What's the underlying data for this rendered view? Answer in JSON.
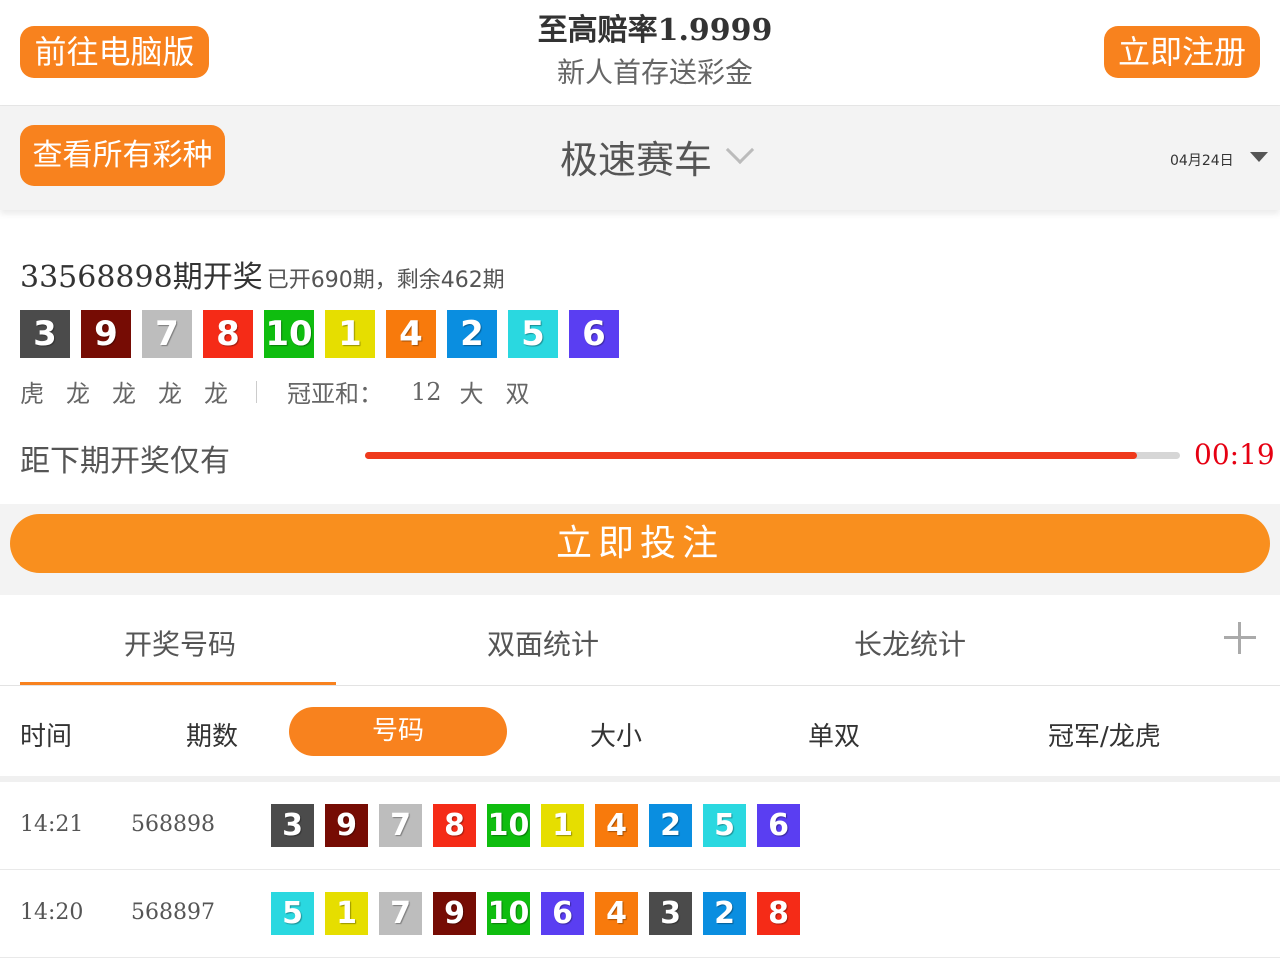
{
  "header": {
    "pc_button": "前往电脑版",
    "promo_line1": "至高赔率1.9999",
    "promo_line2": "新人首存送彩金",
    "register_button": "立即注册"
  },
  "selector": {
    "all_button": "查看所有彩种",
    "game_name": "极速赛车",
    "date": "04月24日"
  },
  "ball_colors": {
    "1": "#e6de00",
    "2": "#0a8ee0",
    "3": "#4b4b4b",
    "4": "#f87a0c",
    "5": "#2ad8e0",
    "6": "#5a3ef2",
    "7": "#bdbdbd",
    "8": "#f52b17",
    "9": "#760c04",
    "10": "#0fbd0f"
  },
  "draw": {
    "period": "33568898期开奖",
    "period_sub": "已开690期，剩余462期",
    "balls": [
      "3",
      "9",
      "7",
      "8",
      "10",
      "1",
      "4",
      "2",
      "5",
      "6"
    ],
    "dragon_tiger": [
      "虎",
      "龙",
      "龙",
      "龙",
      "龙"
    ],
    "sum_label": "冠亚和：",
    "sum_value": "12",
    "sum_size": "大",
    "sum_parity": "双",
    "countdown_label": "距下期开奖仅有",
    "countdown_progress": 0.947,
    "countdown_time": "00:19"
  },
  "bet_button": "立即投注",
  "tabs": [
    "开奖号码",
    "双面统计",
    "长龙统计"
  ],
  "subtabs": [
    "时间",
    "期数",
    "号码",
    "大小",
    "单双",
    "冠军/龙虎"
  ],
  "history": [
    {
      "time": "14:21",
      "issue": "568898",
      "balls": [
        "3",
        "9",
        "7",
        "8",
        "10",
        "1",
        "4",
        "2",
        "5",
        "6"
      ]
    },
    {
      "time": "14:20",
      "issue": "568897",
      "balls": [
        "5",
        "1",
        "7",
        "9",
        "10",
        "6",
        "4",
        "3",
        "2",
        "8"
      ]
    }
  ]
}
